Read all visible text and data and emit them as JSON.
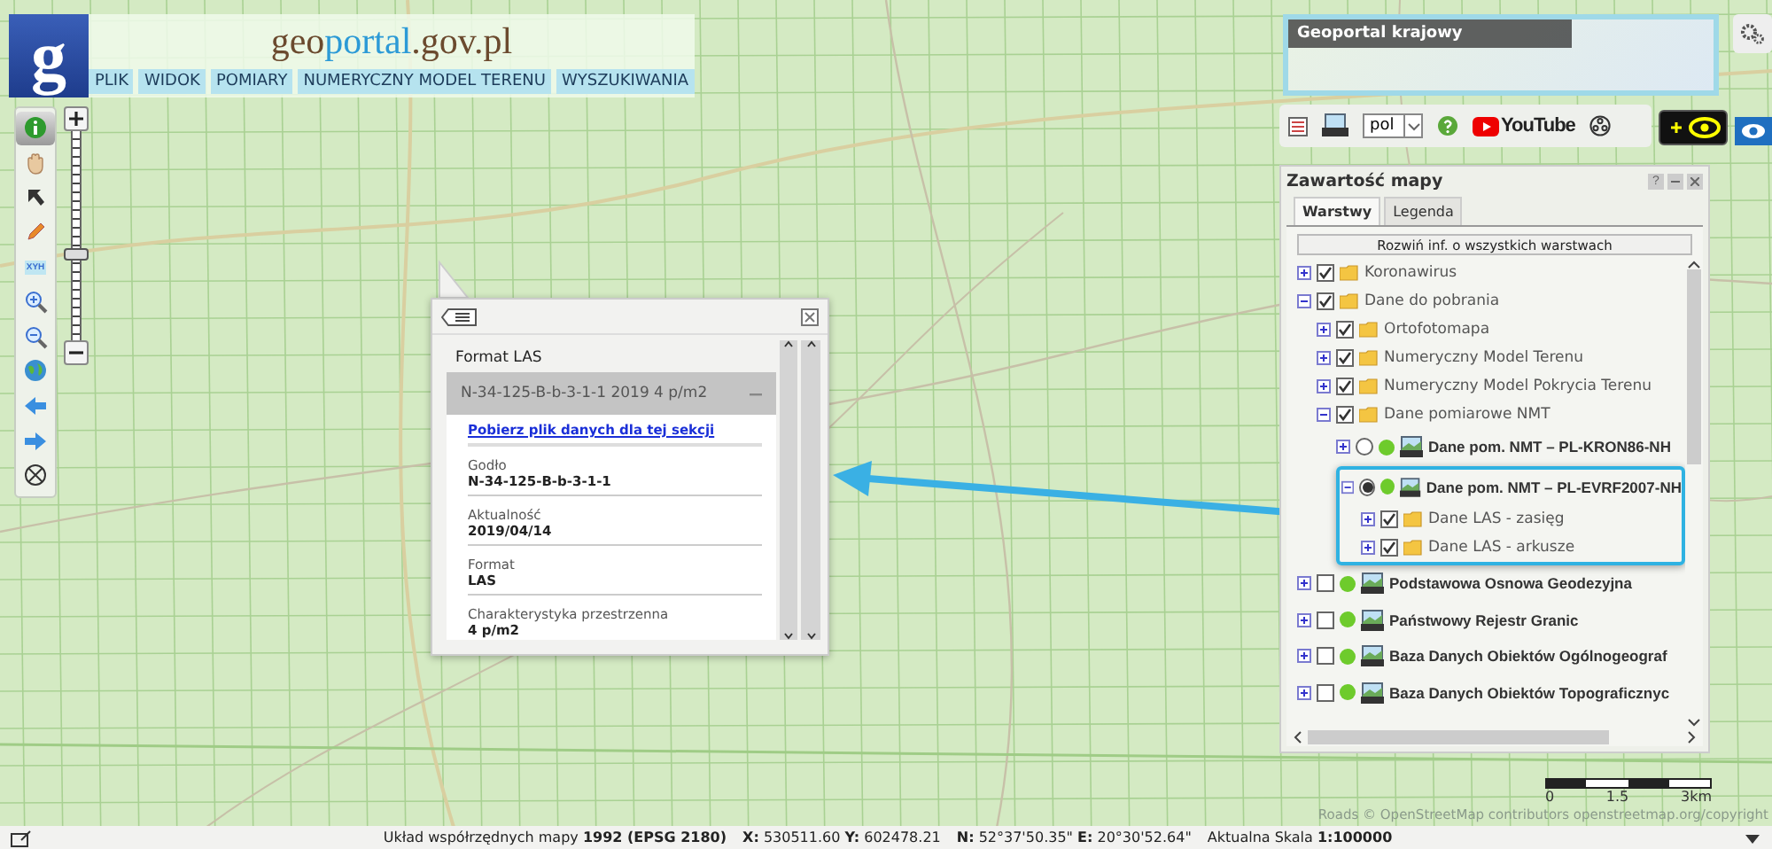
{
  "header": {
    "logo_letter": "g",
    "title_parts": [
      {
        "text": "geo",
        "color": "#6b4a2e"
      },
      {
        "text": "portal",
        "color": "#2c9ad6"
      },
      {
        "text": ".gov.pl",
        "color": "#6b4a2e"
      }
    ],
    "menu": [
      "PLIK",
      "WIDOK",
      "POMIARY",
      "NUMERYCZNY MODEL TERENU",
      "WYSZUKIWANIA"
    ]
  },
  "tools": [
    {
      "kind": "info",
      "selected": true
    },
    {
      "kind": "pan",
      "selected": false
    },
    {
      "kind": "select",
      "selected": false
    },
    {
      "kind": "draw",
      "selected": false
    },
    {
      "kind": "coords",
      "label": "XYH",
      "selected": false
    },
    {
      "kind": "zoomin",
      "selected": false
    },
    {
      "kind": "zoomout",
      "selected": false
    },
    {
      "kind": "globe",
      "selected": false
    },
    {
      "kind": "back",
      "selected": false
    },
    {
      "kind": "forward",
      "selected": false
    },
    {
      "kind": "extent",
      "selected": false
    }
  ],
  "zoom": {
    "level": 0.43
  },
  "minimap": {
    "label": "Geoportal krajowy"
  },
  "top_toolbar": {
    "language": "pol",
    "video_label": "YouTube"
  },
  "popup": {
    "title": "Format LAS",
    "section": "N-34-125-B-b-3-1-1 2019 4 p/m2",
    "section_expanded": true,
    "link": "Pobierz plik danych dla tej sekcji",
    "fields": [
      {
        "label": "Godło",
        "value": "N-34-125-B-b-3-1-1"
      },
      {
        "label": "Aktualność",
        "value": "2019/04/14"
      },
      {
        "label": "Format",
        "value": "LAS"
      },
      {
        "label": "Charakterystyka przestrzenna",
        "value": "4 p/m2"
      }
    ]
  },
  "panel": {
    "title": "Zawartość mapy",
    "help": "?",
    "tabs": [
      {
        "label": "Warstwy",
        "selected": true
      },
      {
        "label": "Legenda",
        "selected": false
      }
    ],
    "expand_all": "Rozwiń inf. o wszystkich warstwach",
    "tree": [
      {
        "kind": "folder",
        "name": "Koronawirus",
        "expanded": false,
        "checked": true
      },
      {
        "kind": "folder",
        "name": "Dane do pobrania",
        "expanded": true,
        "checked": true,
        "children": [
          {
            "kind": "folder",
            "name": "Ortofotomapa",
            "expanded": false,
            "checked": true
          },
          {
            "kind": "folder",
            "name": "Numeryczny Model Terenu",
            "expanded": false,
            "checked": true
          },
          {
            "kind": "folder",
            "name": "Numeryczny Model Pokrycia Terenu",
            "expanded": false,
            "checked": true
          },
          {
            "kind": "folder",
            "name": "Dane pomiarowe NMT",
            "expanded": true,
            "checked": true,
            "children": [
              {
                "kind": "service-radio",
                "name": "Dane pom. NMT – PL-KRON86-NH",
                "expanded": false,
                "checked": false,
                "highlighted": false
              },
              {
                "kind": "service-radio",
                "name": "Dane pom. NMT – PL-EVRF2007-NH",
                "expanded": true,
                "checked": true,
                "highlighted": true,
                "children": [
                  {
                    "kind": "folder",
                    "name": "Dane LAS - zasięg",
                    "expanded": false,
                    "checked": true
                  },
                  {
                    "kind": "folder",
                    "name": "Dane LAS - arkusze",
                    "expanded": false,
                    "checked": true
                  }
                ]
              }
            ]
          }
        ]
      },
      {
        "kind": "service-check",
        "name": "Podstawowa Osnowa Geodezyjna",
        "expanded": false,
        "checked": false,
        "highlighted": false
      },
      {
        "kind": "service-check",
        "name": "Państwowy Rejestr Granic",
        "expanded": false,
        "checked": false,
        "highlighted": false
      },
      {
        "kind": "service-check",
        "name": "Baza Danych Obiektów Ogólnogeograf",
        "expanded": false,
        "checked": false,
        "highlighted": false
      },
      {
        "kind": "service-check",
        "name": "Baza Danych Obiektów Topograficznyc",
        "expanded": false,
        "checked": false,
        "highlighted": false
      }
    ]
  },
  "scale": {
    "ticks": [
      "0",
      "1.5",
      "3km"
    ]
  },
  "attribution": "Roads © OpenStreetMap contributors openstreetmap.org/copyright",
  "status_bar": [
    "Układ współrzędnych mapy **1992 (EPSG 2180)**",
    "**X:** 530511.60 **Y:** 602478.21",
    "**N:** 52°37'50.35\" **E:** 20°30'52.64\"",
    "Aktualna Skala **1:100000**"
  ]
}
